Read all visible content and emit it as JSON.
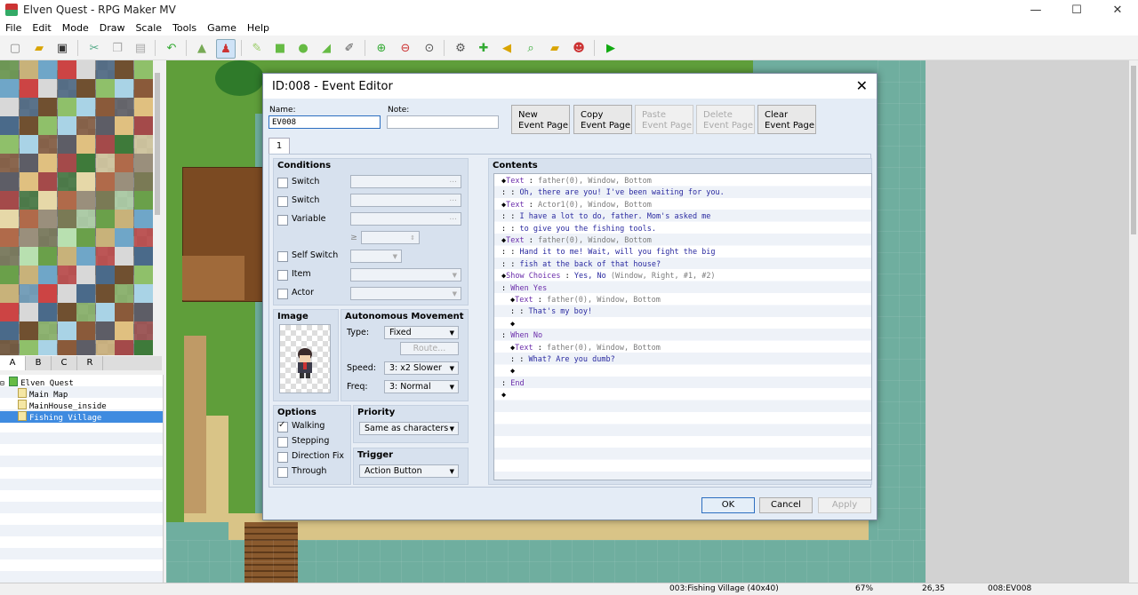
{
  "window": {
    "title": "Elven Quest - RPG Maker MV"
  },
  "menu": [
    "File",
    "Edit",
    "Mode",
    "Draw",
    "Scale",
    "Tools",
    "Game",
    "Help"
  ],
  "tileset_tabs": [
    "A",
    "B",
    "C",
    "R"
  ],
  "map_tree": {
    "project": "Elven Quest",
    "maps": [
      "Main Map",
      "MainHouse_inside",
      "Fishing Village"
    ],
    "selected": "Fishing Village"
  },
  "status": {
    "map": "003:Fishing Village (40x40)",
    "zoom": "67%",
    "coords": "26,35",
    "event": "008:EV008"
  },
  "dialog": {
    "title": "ID:008 - Event Editor",
    "close_glyph": "✕",
    "name_label": "Name:",
    "name_value": "EV008",
    "note_label": "Note:",
    "note_value": "",
    "page_buttons": [
      {
        "line1": "New",
        "line2": "Event Page",
        "enabled": true
      },
      {
        "line1": "Copy",
        "line2": "Event Page",
        "enabled": true
      },
      {
        "line1": "Paste",
        "line2": "Event Page",
        "enabled": false
      },
      {
        "line1": "Delete",
        "line2": "Event Page",
        "enabled": false
      },
      {
        "line1": "Clear",
        "line2": "Event Page",
        "enabled": true
      }
    ],
    "page_tab": "1",
    "conditions": {
      "heading": "Conditions",
      "switch1": "Switch",
      "switch2": "Switch",
      "variable": "Variable",
      "ge": "≥",
      "self_switch": "Self Switch",
      "item": "Item",
      "actor": "Actor",
      "ellipsis": "..."
    },
    "image": {
      "heading": "Image"
    },
    "autonomous": {
      "heading": "Autonomous Movement",
      "type_label": "Type:",
      "type_value": "Fixed",
      "route_label": "Route...",
      "speed_label": "Speed:",
      "speed_value": "3: x2 Slower",
      "freq_label": "Freq:",
      "freq_value": "3: Normal"
    },
    "options": {
      "heading": "Options",
      "walking": "Walking",
      "walking_checked": true,
      "stepping": "Stepping",
      "direction_fix": "Direction Fix",
      "through": "Through"
    },
    "priority": {
      "heading": "Priority",
      "value": "Same as characters"
    },
    "trigger": {
      "heading": "Trigger",
      "value": "Action Button"
    },
    "contents": {
      "heading": "Contents",
      "lines": [
        {
          "indent": 0,
          "prefix": "◆",
          "cmd": "Text",
          "sep": " : ",
          "arg": "father(0), Window, Bottom",
          "text": ""
        },
        {
          "indent": 0,
          "prefix": " ",
          "cmd": "",
          "sep": ":     : ",
          "arg": "",
          "text": "Oh, there are you! I've been waiting for you."
        },
        {
          "indent": 0,
          "prefix": "◆",
          "cmd": "Text",
          "sep": " : ",
          "arg": "Actor1(0), Window, Bottom",
          "text": ""
        },
        {
          "indent": 0,
          "prefix": " ",
          "cmd": "",
          "sep": ":     : ",
          "arg": "",
          "text": "I have a lot to do, father. Mom's asked me"
        },
        {
          "indent": 0,
          "prefix": " ",
          "cmd": "",
          "sep": ":     : ",
          "arg": "",
          "text": "to give you the fishing tools."
        },
        {
          "indent": 0,
          "prefix": "◆",
          "cmd": "Text",
          "sep": " : ",
          "arg": "father(0), Window, Bottom",
          "text": ""
        },
        {
          "indent": 0,
          "prefix": " ",
          "cmd": "",
          "sep": ":     : ",
          "arg": "",
          "text": "Hand it to me! Wait, will you fight the big"
        },
        {
          "indent": 0,
          "prefix": " ",
          "cmd": "",
          "sep": ":     : ",
          "arg": "",
          "text": "fish at the back of that house?"
        },
        {
          "indent": 0,
          "prefix": "◆",
          "cmd": "Show Choices",
          "sep": " : ",
          "arg": "",
          "text": "Yes, No",
          "arg2": " (Window, Right, #1, #2)"
        },
        {
          "indent": 0,
          "prefix": " ",
          "cmd": "",
          "sep": ": ",
          "arg": "",
          "text": "",
          "branch": "When Yes"
        },
        {
          "indent": 1,
          "prefix": "◆",
          "cmd": "Text",
          "sep": " : ",
          "arg": "father(0), Window, Bottom",
          "text": ""
        },
        {
          "indent": 1,
          "prefix": " ",
          "cmd": "",
          "sep": ":     : ",
          "arg": "",
          "text": "That's my boy!"
        },
        {
          "indent": 1,
          "prefix": "◆",
          "cmd": "",
          "sep": "",
          "arg": "",
          "text": ""
        },
        {
          "indent": 0,
          "prefix": " ",
          "cmd": "",
          "sep": ": ",
          "arg": "",
          "text": "",
          "branch": "When No"
        },
        {
          "indent": 1,
          "prefix": "◆",
          "cmd": "Text",
          "sep": " : ",
          "arg": "father(0), Window, Bottom",
          "text": ""
        },
        {
          "indent": 1,
          "prefix": " ",
          "cmd": "",
          "sep": ":     : ",
          "arg": "",
          "text": "What? Are you dumb?"
        },
        {
          "indent": 1,
          "prefix": "◆",
          "cmd": "",
          "sep": "",
          "arg": "",
          "text": ""
        },
        {
          "indent": 0,
          "prefix": " ",
          "cmd": "",
          "sep": ": ",
          "arg": "",
          "text": "",
          "branch": "End"
        },
        {
          "indent": 0,
          "prefix": "◆",
          "cmd": "",
          "sep": "",
          "arg": "",
          "text": ""
        }
      ]
    },
    "buttons": {
      "ok": "OK",
      "cancel": "Cancel",
      "apply": "Apply"
    }
  },
  "colors": {
    "accent": "#3f8be0",
    "command": "#6a2caa",
    "dialogue": "#2a2aa0",
    "water": "#6fae9f",
    "grass": "#5f9e3a"
  }
}
